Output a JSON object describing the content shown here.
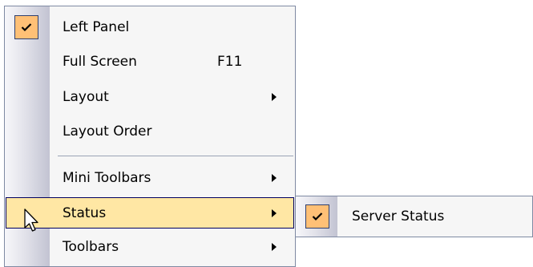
{
  "main_menu": {
    "items": [
      {
        "label": "Left Panel",
        "checked": true
      },
      {
        "label": "Full Screen",
        "shortcut": "F11"
      },
      {
        "label": "Layout",
        "has_submenu": true
      },
      {
        "label": "Layout Order"
      },
      {
        "label": "Mini Toolbars",
        "has_submenu": true
      },
      {
        "label": "Status",
        "has_submenu": true,
        "highlighted": true
      },
      {
        "label": "Toolbars",
        "has_submenu": true
      }
    ]
  },
  "submenu": {
    "items": [
      {
        "label": "Server Status",
        "checked": true
      }
    ]
  },
  "colors": {
    "highlight_bg": "#ffe7a4",
    "check_bg": "#ffc076",
    "border": "#7f8aa3"
  },
  "icons": {
    "check": "checkmark-icon",
    "submenu": "submenu-arrow-icon",
    "cursor": "mouse-pointer-icon"
  }
}
